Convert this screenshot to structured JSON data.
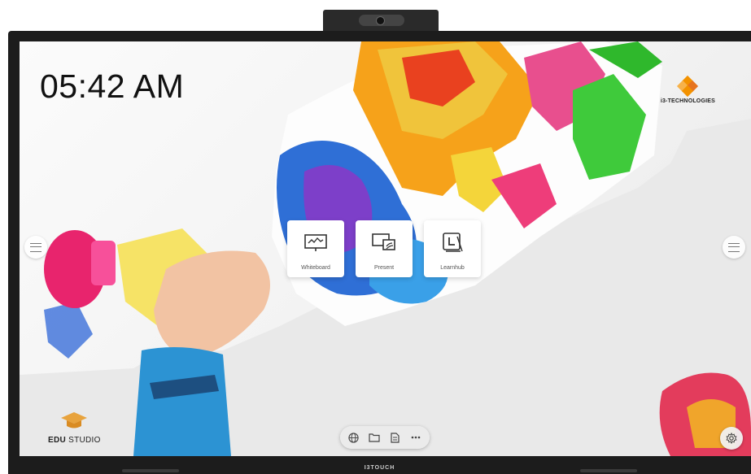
{
  "device": {
    "bezel_label": "I3TOUCH"
  },
  "home": {
    "clock": "05:42 AM",
    "brand_label": "i3-TECHNOLOGIES",
    "apps": [
      {
        "label": "Whiteboard",
        "icon": "whiteboard-icon"
      },
      {
        "label": "Present",
        "icon": "present-icon"
      },
      {
        "label": "Learnhub",
        "icon": "learnhub-icon"
      }
    ],
    "edu_studio": {
      "bold": "EDU",
      "rest": " STUDIO"
    },
    "dock": [
      {
        "icon": "globe-icon"
      },
      {
        "icon": "folder-icon"
      },
      {
        "icon": "document-icon"
      },
      {
        "icon": "more-icon"
      }
    ],
    "settings_icon": "gear-icon"
  },
  "colors": {
    "brand_orange": "#F39200",
    "cap_orange": "#E8A33D",
    "bezel": "#1C1C1C"
  }
}
